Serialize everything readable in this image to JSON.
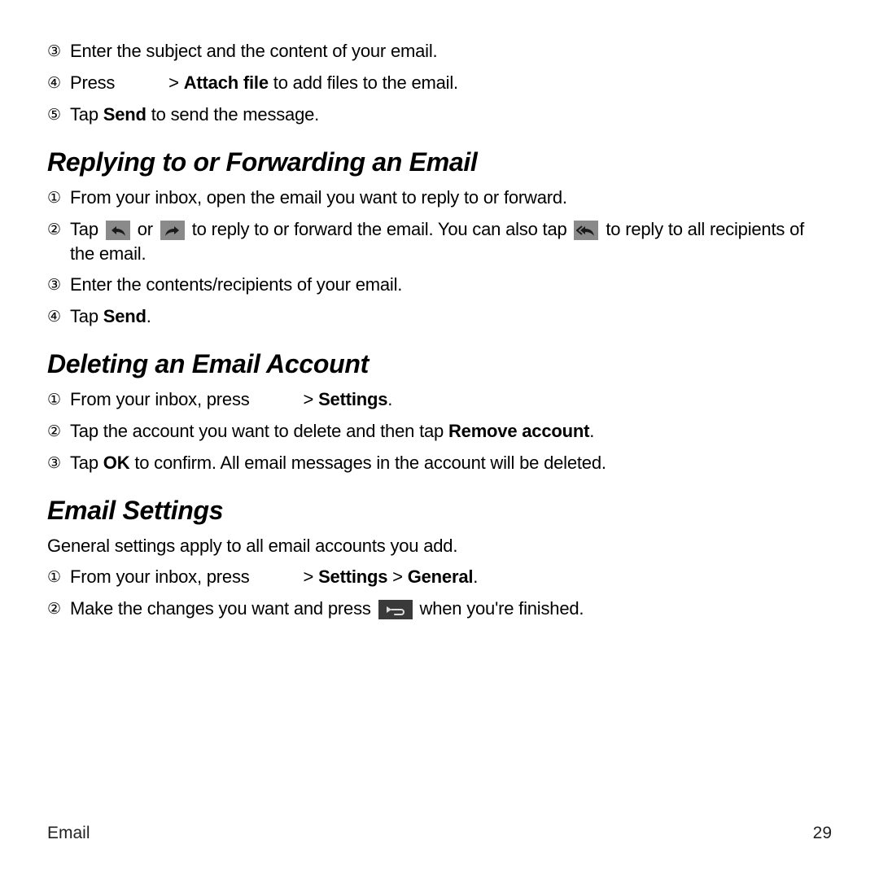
{
  "top_steps": [
    {
      "marker": "③",
      "parts": [
        {
          "t": "Enter the subject and the content of your email."
        }
      ]
    },
    {
      "marker": "④",
      "parts": [
        {
          "t": "Press"
        },
        {
          "gap": true
        },
        {
          "t": " > "
        },
        {
          "b": "Attach file"
        },
        {
          "t": " to add files to the email."
        }
      ]
    },
    {
      "marker": "⑤",
      "parts": [
        {
          "t": "Tap "
        },
        {
          "b": "Send"
        },
        {
          "t": " to send the message."
        }
      ]
    }
  ],
  "sections": [
    {
      "heading": "Replying to or Forwarding an Email",
      "intro": null,
      "steps": [
        {
          "marker": "①",
          "parts": [
            {
              "t": "From your inbox, open the email you want to reply to or forward."
            }
          ]
        },
        {
          "marker": "②",
          "parts": [
            {
              "t": "Tap "
            },
            {
              "icon": "reply"
            },
            {
              "t": " or "
            },
            {
              "icon": "forward"
            },
            {
              "t": " to reply to or forward the email. You can also tap "
            },
            {
              "icon": "reply-all"
            },
            {
              "t": " to reply to all recipients of the email."
            }
          ]
        },
        {
          "marker": "③",
          "parts": [
            {
              "t": "Enter the contents/recipients of your email."
            }
          ]
        },
        {
          "marker": "④",
          "parts": [
            {
              "t": "Tap "
            },
            {
              "b": "Send"
            },
            {
              "t": "."
            }
          ]
        }
      ]
    },
    {
      "heading": "Deleting an Email Account",
      "intro": null,
      "steps": [
        {
          "marker": "①",
          "parts": [
            {
              "t": "From your inbox, press"
            },
            {
              "gap": true
            },
            {
              "t": " > "
            },
            {
              "b": "Settings"
            },
            {
              "t": "."
            }
          ]
        },
        {
          "marker": "②",
          "parts": [
            {
              "t": "Tap the account you want to delete and then tap "
            },
            {
              "b": "Remove account"
            },
            {
              "t": "."
            }
          ]
        },
        {
          "marker": "③",
          "parts": [
            {
              "t": "Tap "
            },
            {
              "b": "OK"
            },
            {
              "t": " to confirm. All email messages in the account will be deleted."
            }
          ]
        }
      ]
    },
    {
      "heading": "Email Settings",
      "intro": "General settings apply to all email accounts you add.",
      "steps": [
        {
          "marker": "①",
          "parts": [
            {
              "t": "From your inbox, press"
            },
            {
              "gap": true
            },
            {
              "t": " > "
            },
            {
              "b": "Settings"
            },
            {
              "t": " > "
            },
            {
              "b": "General"
            },
            {
              "t": "."
            }
          ]
        },
        {
          "marker": "②",
          "parts": [
            {
              "t": "Make the changes you want and press "
            },
            {
              "icon": "back"
            },
            {
              "t": " when you're finished."
            }
          ]
        }
      ]
    }
  ],
  "footer": {
    "section": "Email",
    "page": "29"
  }
}
